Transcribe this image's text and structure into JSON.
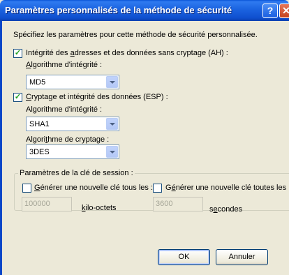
{
  "window": {
    "title": "Paramètres personnalisés de la méthode de sécurité",
    "help_glyph": "?",
    "close_glyph": "✕"
  },
  "intro": "Spécifiez les paramètres pour cette méthode de sécurité personnalisée.",
  "ah": {
    "checked": true,
    "label_pre": "Intégrité des ",
    "label_mn": "a",
    "label_post": "dresses et des données sans cryptage (AH) :",
    "algo_label_mn": "A",
    "algo_label_rest": "lgorithme d'intégrité :",
    "algo_value": "MD5"
  },
  "esp": {
    "checked": true,
    "label_mn": "C",
    "label_rest": "ryptage et intégrité des données (ESP) :",
    "integrity_label_pre": "Al",
    "integrity_label_mn": "g",
    "integrity_label_post": "orithme d'intégrité :",
    "integrity_value": "SHA1",
    "encryption_label_pre": "Algori",
    "encryption_label_mn": "t",
    "encryption_label_post": "hme de cryptage :",
    "encryption_value": "3DES"
  },
  "session": {
    "group_label": "Paramètres de la clé de session :",
    "kb": {
      "checked": false,
      "label_mn": "G",
      "label_rest": "énérer une nouvelle clé tous les :",
      "value": "100000",
      "unit_mn": "k",
      "unit_rest": "ilo-octets"
    },
    "sec": {
      "checked": false,
      "label_pre": "G",
      "label_mn": "é",
      "label_post": "nérer une nouvelle clé toutes les :",
      "value": "3600",
      "unit_pre": "s",
      "unit_mn": "e",
      "unit_post": "condes"
    }
  },
  "buttons": {
    "ok": "OK",
    "cancel": "Annuler"
  },
  "check_glyph": "✓"
}
